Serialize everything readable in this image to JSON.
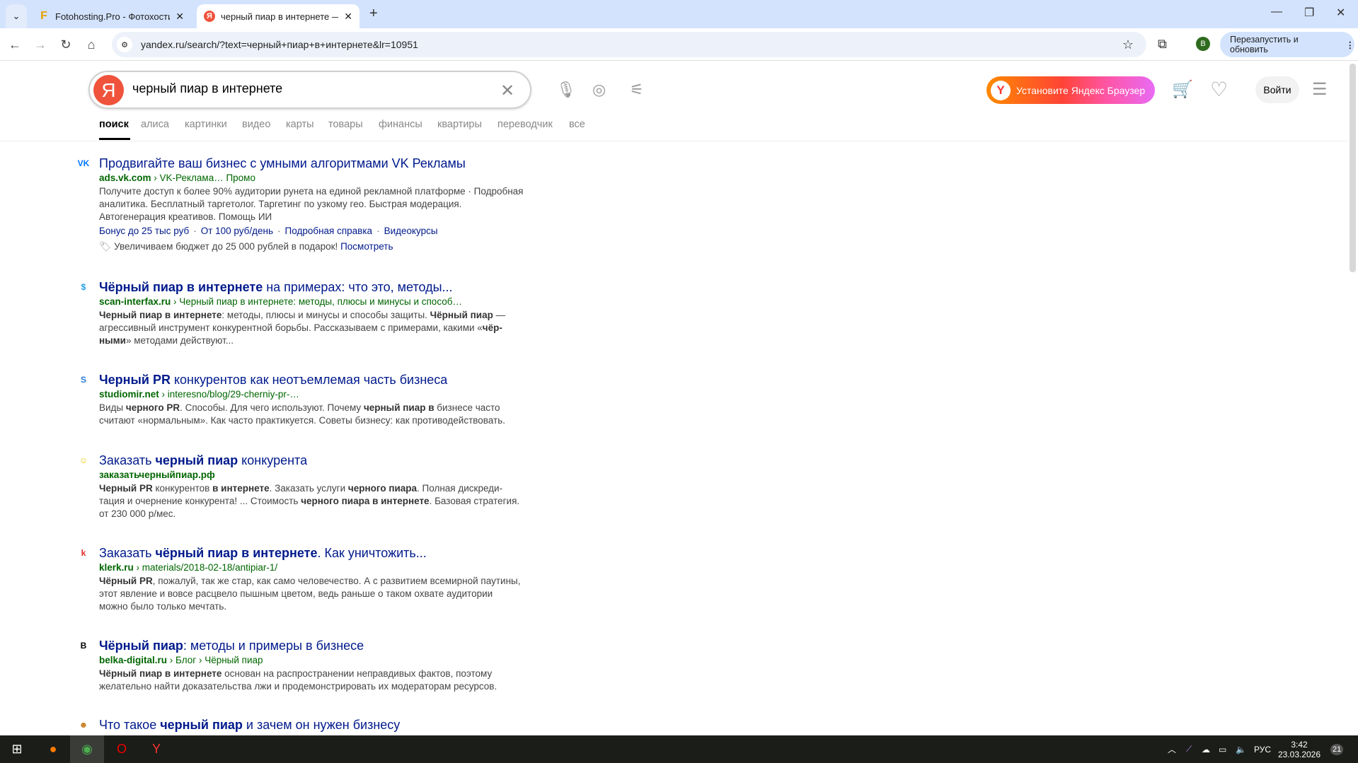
{
  "browser": {
    "tabs": [
      {
        "title": "Fotohosting.Pro - Фотохостинг",
        "favicon": "F"
      },
      {
        "title": "черный пиар в интернете — Я",
        "favicon": "Я",
        "active": true
      }
    ],
    "url": "yandex.ru/search/?text=черный+пиар+в+интернете&lr=10951",
    "profile_initial": "B",
    "restart_label": "Перезапустить и обновить"
  },
  "search": {
    "logo": "Я",
    "query": "черный пиар в интернете"
  },
  "header": {
    "install_label": "Установите Яндекс Браузер",
    "install_logo": "Y",
    "login_label": "Войти"
  },
  "verticals": [
    "поиск",
    "алиса",
    "картинки",
    "видео",
    "карты",
    "товары",
    "финансы",
    "квартиры",
    "переводчик",
    "все"
  ],
  "results": [
    {
      "fav": "VK",
      "favColor": "#0077ff",
      "title": [
        [
          "Продвигайте ваш бизнес с умными алгоритмами VK Рекламы",
          0
        ]
      ],
      "url": [
        [
          "ads.vk.com",
          1
        ],
        [
          " › VK-Реклама…  ",
          0
        ],
        [
          "Промо",
          0
        ]
      ],
      "snippet": [
        [
          "Получите доступ к более 90% аудитории рунета на единой рекламной платформе · По­дробная аналитика. Бесплатный таргетолог. Таргетинг по узкому гео. Быстрая модерация. Автогенерация креативов. Помощь ИИ",
          0
        ]
      ],
      "links": [
        "Бонус до 25 тыс руб",
        "От 100 руб/день",
        "Подробная справка",
        "Видеокурсы"
      ],
      "promo": {
        "text": "Увеличиваем бюджет до 25 000 рублей в подарок!",
        "link": "Посмотреть"
      }
    },
    {
      "fav": "$",
      "favColor": "#1e9be8",
      "title": [
        [
          "Чёрный пиар в интернете",
          1
        ],
        [
          " на примерах: что это, методы...",
          0
        ]
      ],
      "url": [
        [
          "scan-interfax.ru",
          1
        ],
        [
          " › Черный пиар в интернете: методы, плюсы и минусы и способ…",
          0
        ]
      ],
      "snippet": [
        [
          "Черный пиар в интернете",
          1
        ],
        [
          ": методы, плюсы и минусы и способы защиты. ",
          0
        ],
        [
          "Чёрный пиар",
          1
        ],
        [
          " — агрессивный инструмент конкурентной борьбы. Рассказываем с примерами, какими «",
          0
        ],
        [
          "чёр­ными",
          1
        ],
        [
          "» методами действуют...",
          0
        ]
      ]
    },
    {
      "fav": "S",
      "favColor": "#2a7bd6",
      "title": [
        [
          "Черный PR",
          1
        ],
        [
          " конкурентов как неотъемлемая часть бизнеса",
          0
        ]
      ],
      "url": [
        [
          "studiomir.net",
          1
        ],
        [
          " › interesno/blog/29-cherniy-pr-…",
          0
        ]
      ],
      "snippet": [
        [
          "Виды ",
          0
        ],
        [
          "черного PR",
          1
        ],
        [
          ". Способы. Для чего используют. Почему ",
          0
        ],
        [
          "черный пиар в",
          1
        ],
        [
          " бизнесе часто считают «нормальным». Как часто практикуется. Советы бизнесу: как противодействовать.",
          0
        ]
      ]
    },
    {
      "fav": "☺",
      "favColor": "#e8c800",
      "title": [
        [
          "Заказать ",
          0
        ],
        [
          "черный пиар",
          1
        ],
        [
          " конкурента",
          0
        ]
      ],
      "url": [
        [
          "заказатьчерныйпиар.рф",
          1
        ]
      ],
      "snippet": [
        [
          "Черный PR",
          1
        ],
        [
          " конкурентов ",
          0
        ],
        [
          "в интернете",
          1
        ],
        [
          ". Заказать услуги ",
          0
        ],
        [
          "черного пиара",
          1
        ],
        [
          ". Полная дискреди­тация и очернение конкурента! ... Стоимость ",
          0
        ],
        [
          "черного пиара в интернете",
          1
        ],
        [
          ". Базовая стра­тегия. от 230 000 р/мес.",
          0
        ]
      ]
    },
    {
      "fav": "k",
      "favColor": "#e02a2a",
      "title": [
        [
          "Заказать ",
          0
        ],
        [
          "чёрный пиар в интернете",
          1
        ],
        [
          ". Как уничтожить...",
          0
        ]
      ],
      "url": [
        [
          "klerk.ru",
          1
        ],
        [
          " › materials/2018-02-18/antipiar-1/",
          0
        ]
      ],
      "snippet": [
        [
          "Чёрный PR",
          1
        ],
        [
          ", пожалуй, так же стар, как само человечество. А с развитием всемирной пау­тины, этот явление и вовсе расцвело пышным цветом, ведь раньше о таком охвате ауди­тории можно было только мечтать.",
          0
        ]
      ]
    },
    {
      "fav": "B",
      "favColor": "#000000",
      "title": [
        [
          "Чёрный пиар",
          1
        ],
        [
          ": методы и примеры в бизнесе",
          0
        ]
      ],
      "url": [
        [
          "belka-digital.ru",
          1
        ],
        [
          " › Блог › Чёрный пиар",
          0
        ]
      ],
      "snippet": [
        [
          "Чёрный пиар в интернете",
          1
        ],
        [
          " основан на распространении неправдивых фактов, поэтому желательно найти доказательства лжи и продемонстрировать их модераторам ресурсов.",
          0
        ]
      ]
    },
    {
      "fav": "☻",
      "favColor": "#c77a1e",
      "title": [
        [
          "Что такое ",
          0
        ],
        [
          "черный пиар",
          1
        ],
        [
          " и зачем он нужен бизнесу",
          0
        ]
      ],
      "url": [],
      "snippet": []
    }
  ],
  "taskbar": {
    "lang": "РУС",
    "time": "3:42",
    "date": "23.03.2026",
    "notifications": "21"
  },
  "colors": {
    "link": "#001a8c",
    "url": "#006600",
    "accent": "#f0533c"
  }
}
